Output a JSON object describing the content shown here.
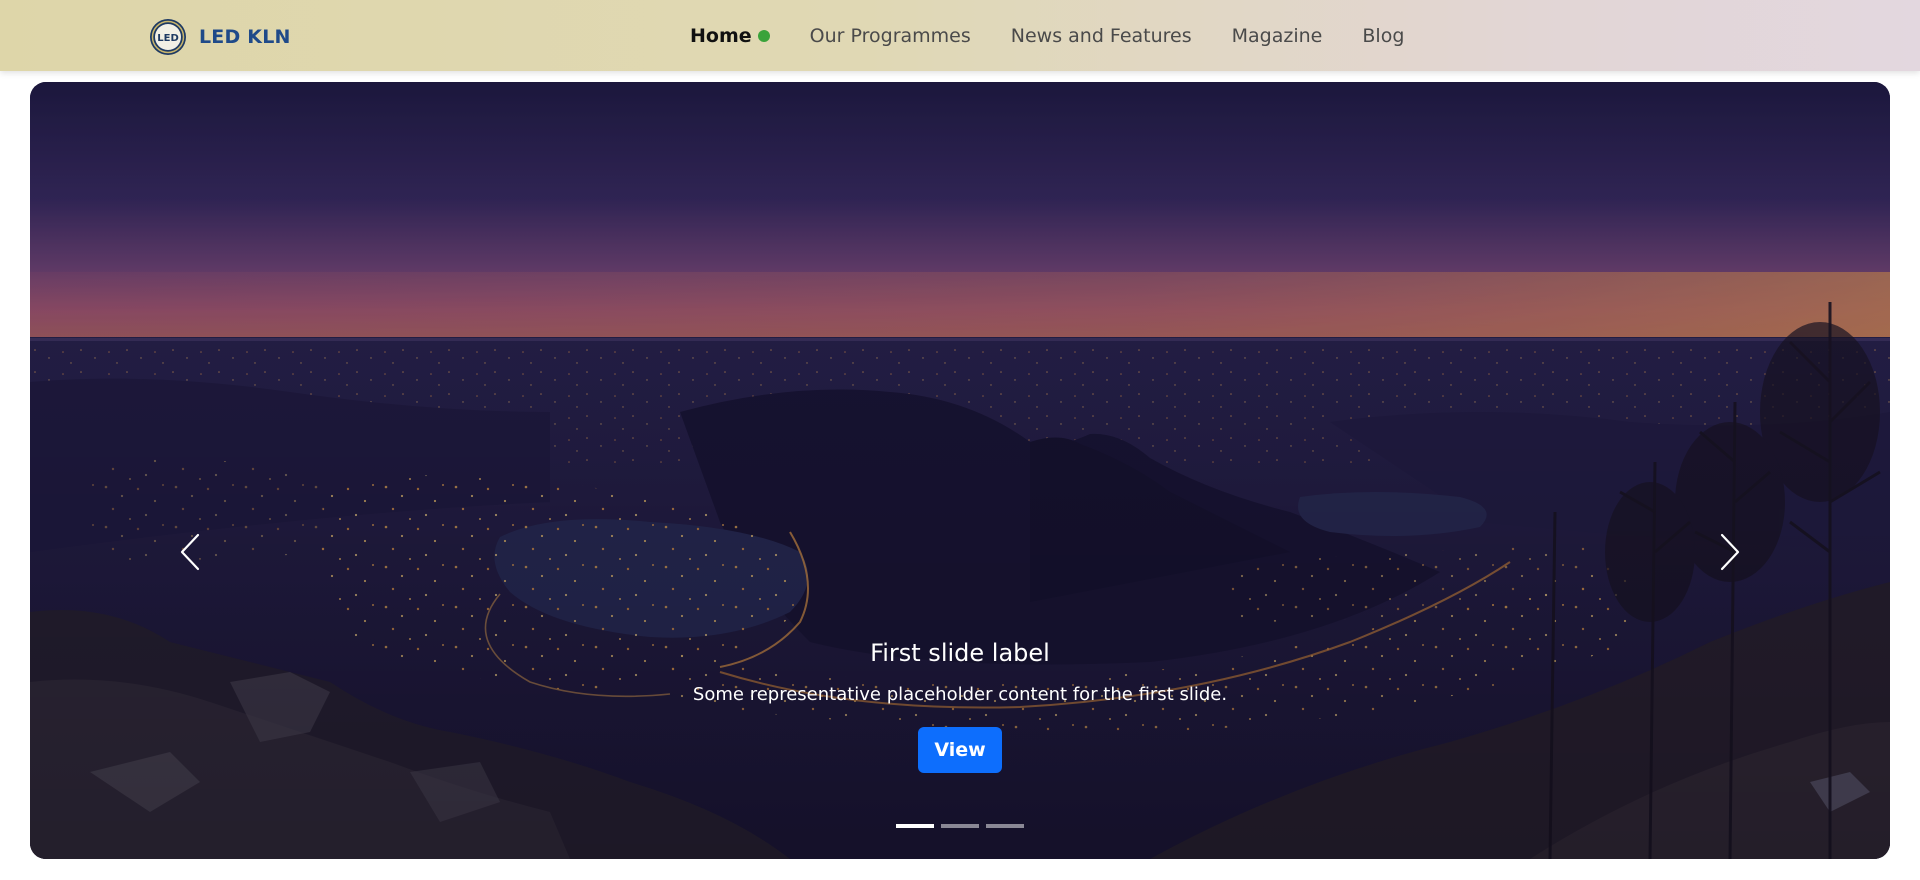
{
  "brand": {
    "name": "LED KLN",
    "logo_icon": "led-logo-icon",
    "name_color": "#1f4a89"
  },
  "nav": {
    "items": [
      {
        "label": "Home",
        "active": true
      },
      {
        "label": "Our Programmes",
        "active": false
      },
      {
        "label": "News and Features",
        "active": false
      },
      {
        "label": "Magazine",
        "active": false
      },
      {
        "label": "Blog",
        "active": false
      }
    ],
    "active_indicator_color": "#3aa33a"
  },
  "carousel": {
    "slide": {
      "title": "First slide label",
      "text": "Some representative placeholder content for the first slide.",
      "button_label": "View"
    },
    "prev_icon": "chevron-left-icon",
    "next_icon": "chevron-right-icon",
    "indicator_count": 3,
    "active_index": 0,
    "button_color": "#0d6efd"
  }
}
